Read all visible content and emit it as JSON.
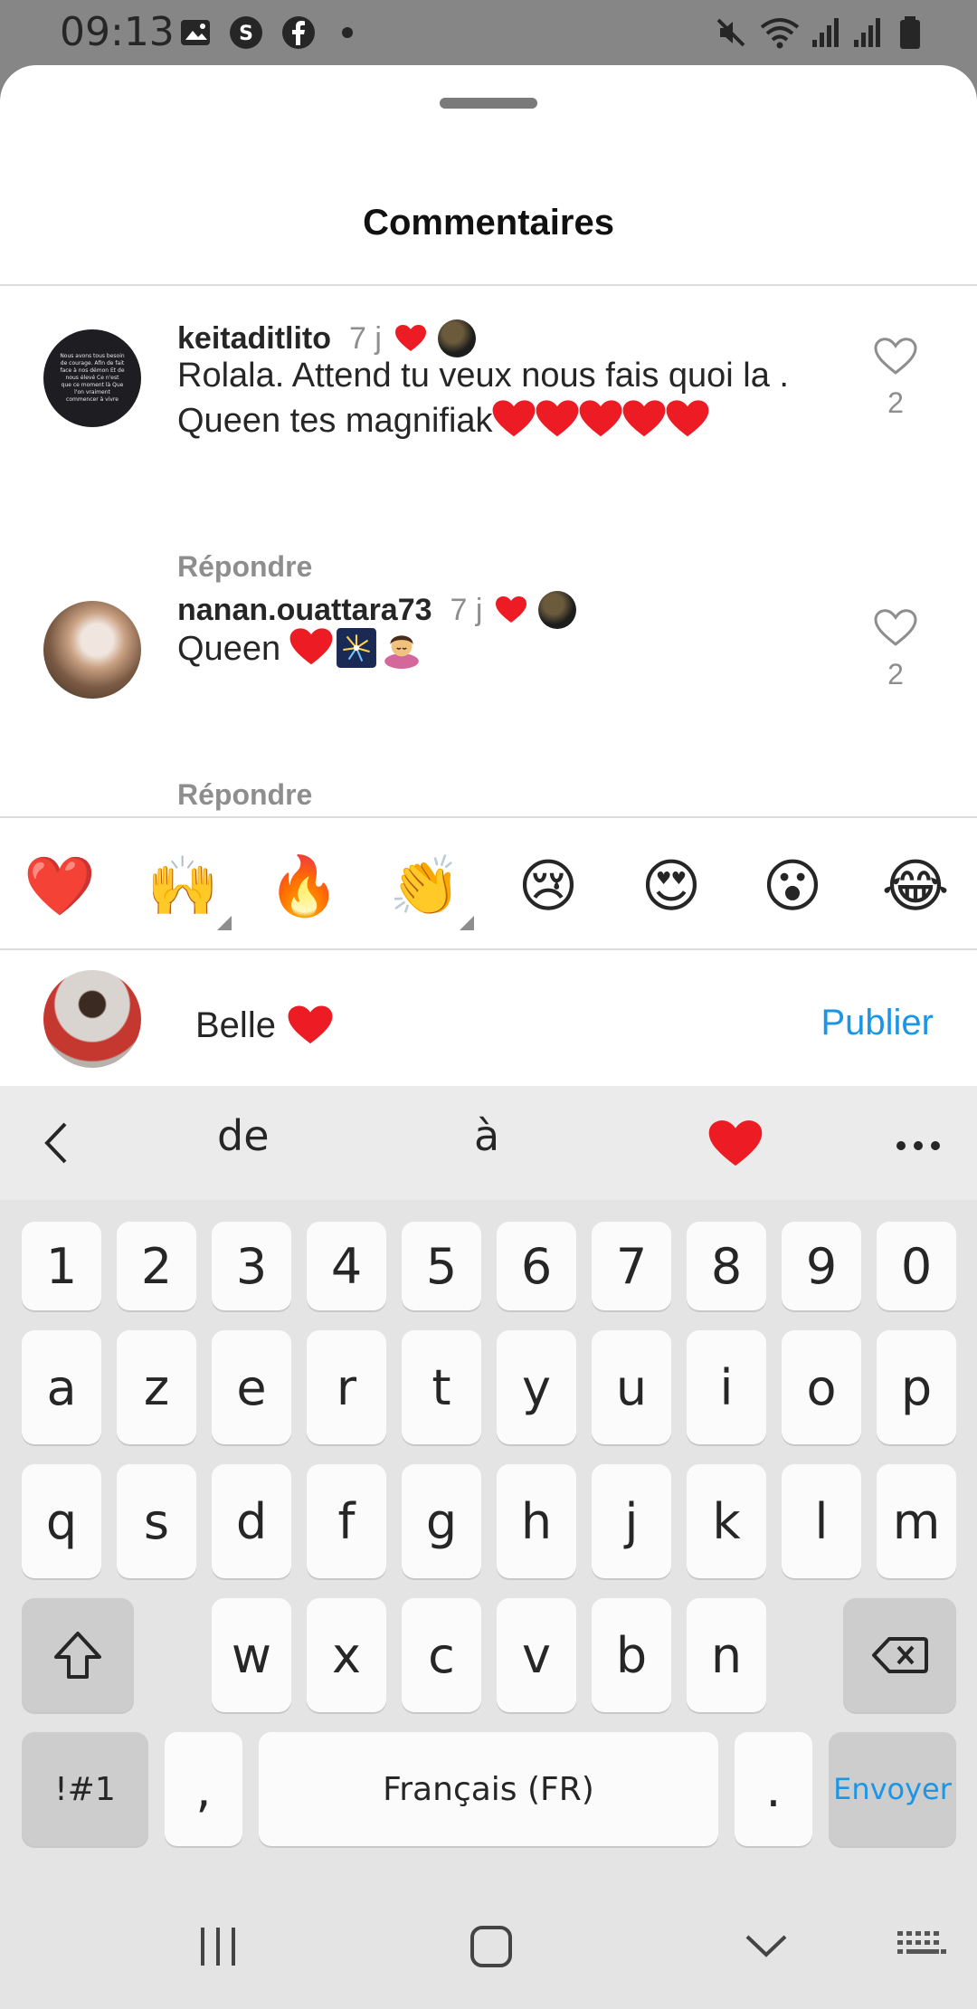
{
  "status_bar": {
    "time": "09:13"
  },
  "sheet": {
    "title": "Commentaires"
  },
  "comments": [
    {
      "username": "keitaditlito",
      "time": "7 j",
      "text": "Rolala. Attend tu veux nous fais quoi la . Queen tes magnifiak",
      "reply_label": "Répondre",
      "likes": "2",
      "avatar_caption": "Nous avons tous besoin de courage. Afin de fait face à nos démon Et de nous élevé Ce n'est que ce moment là Que l'on vraiment commencer à vivre"
    },
    {
      "username": "nanan.ouattara73",
      "time": "7 j",
      "text": "Queen",
      "reply_label": "Répondre",
      "likes": "2"
    }
  ],
  "emoji_bar": [
    "❤️",
    "🙌",
    "🔥",
    "👏",
    "😢",
    "😍",
    "😮",
    "😂"
  ],
  "composer": {
    "text": "Belle",
    "publish_label": "Publier"
  },
  "keyboard": {
    "suggestions": [
      "de",
      "à"
    ],
    "number_row": [
      "1",
      "2",
      "3",
      "4",
      "5",
      "6",
      "7",
      "8",
      "9",
      "0"
    ],
    "row1": [
      "a",
      "z",
      "e",
      "r",
      "t",
      "y",
      "u",
      "i",
      "o",
      "p"
    ],
    "row2": [
      "q",
      "s",
      "d",
      "f",
      "g",
      "h",
      "j",
      "k",
      "l",
      "m"
    ],
    "row3": [
      "w",
      "x",
      "c",
      "v",
      "b",
      "n"
    ],
    "symbols_label": "!#1",
    "comma": ",",
    "space_label": "Français (FR)",
    "period": ".",
    "send_label": "Envoyer"
  },
  "colors": {
    "accent": "#1b95e6",
    "heart": "#ed1c24",
    "muted": "#8e8e8e"
  },
  "icons": [
    "gallery-icon",
    "s-app-icon",
    "facebook-icon",
    "mute-icon",
    "wifi-icon",
    "signal-icon",
    "battery-icon",
    "heart-icon",
    "chevron-left-icon",
    "more-icon",
    "shift-icon",
    "backspace-icon",
    "recents-icon",
    "home-icon",
    "back-icon",
    "keyboard-icon"
  ]
}
